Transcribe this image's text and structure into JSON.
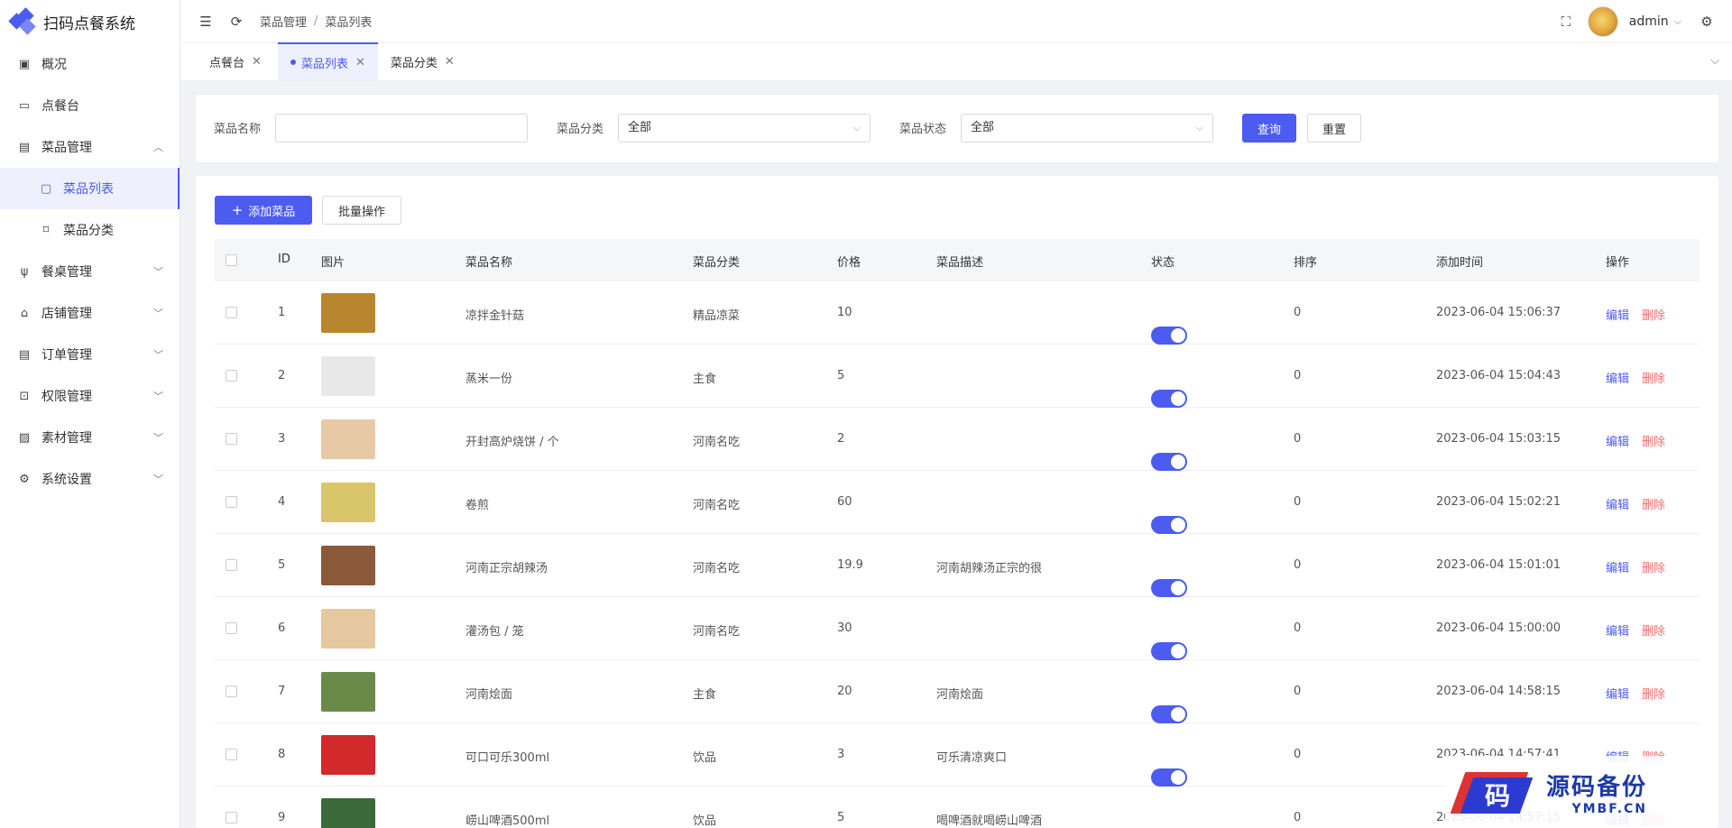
{
  "app": {
    "title": "扫码点餐系统"
  },
  "sidebar": {
    "items": [
      {
        "label": "概况",
        "icon": "dashboard-icon"
      },
      {
        "label": "点餐台",
        "icon": "monitor-icon"
      },
      {
        "label": "菜品管理",
        "icon": "menu-icon",
        "expanded": true
      },
      {
        "label": "菜品列表",
        "icon": "chat-icon",
        "sub": true,
        "active": true
      },
      {
        "label": "菜品分类",
        "icon": "bookmark-icon",
        "sub": true
      },
      {
        "label": "餐桌管理",
        "icon": "cutlery-icon"
      },
      {
        "label": "店铺管理",
        "icon": "store-icon"
      },
      {
        "label": "订单管理",
        "icon": "document-icon"
      },
      {
        "label": "权限管理",
        "icon": "lock-icon"
      },
      {
        "label": "素材管理",
        "icon": "image-icon"
      },
      {
        "label": "系统设置",
        "icon": "gear-icon"
      }
    ]
  },
  "header": {
    "breadcrumb": [
      "菜品管理",
      "菜品列表"
    ],
    "user": "admin"
  },
  "tabs": [
    {
      "label": "点餐台",
      "active": false
    },
    {
      "label": "菜品列表",
      "active": true
    },
    {
      "label": "菜品分类",
      "active": false
    }
  ],
  "search": {
    "name_label": "菜品名称",
    "name_value": "",
    "category_label": "菜品分类",
    "category_value": "全部",
    "status_label": "菜品状态",
    "status_value": "全部",
    "query_button": "查询",
    "reset_button": "重置"
  },
  "toolbar": {
    "add_button": "添加菜品",
    "batch_button": "批量操作"
  },
  "table": {
    "columns": [
      "ID",
      "图片",
      "菜品名称",
      "菜品分类",
      "价格",
      "菜品描述",
      "状态",
      "排序",
      "添加时间",
      "操作"
    ],
    "edit_label": "编辑",
    "delete_label": "删除",
    "rows": [
      {
        "id": "1",
        "name": "凉拌金针菇",
        "category": "精品凉菜",
        "price": "10",
        "desc": "",
        "status": true,
        "sort": "0",
        "time": "2023-06-04 15:06:37",
        "thumb": "#b8862f"
      },
      {
        "id": "2",
        "name": "蒸米一份",
        "category": "主食",
        "price": "5",
        "desc": "",
        "status": true,
        "sort": "0",
        "time": "2023-06-04 15:04:43",
        "thumb": "#e8e8e8"
      },
      {
        "id": "3",
        "name": "开封高炉烧饼 / 个",
        "category": "河南名吃",
        "price": "2",
        "desc": "",
        "status": true,
        "sort": "0",
        "time": "2023-06-04 15:03:15",
        "thumb": "#e8c9a6"
      },
      {
        "id": "4",
        "name": "卷煎",
        "category": "河南名吃",
        "price": "60",
        "desc": "",
        "status": true,
        "sort": "0",
        "time": "2023-06-04 15:02:21",
        "thumb": "#d9c56a"
      },
      {
        "id": "5",
        "name": "河南正宗胡辣汤",
        "category": "河南名吃",
        "price": "19.9",
        "desc": "河南胡辣汤正宗的很",
        "status": true,
        "sort": "0",
        "time": "2023-06-04 15:01:01",
        "thumb": "#8a5a3a"
      },
      {
        "id": "6",
        "name": "灌汤包 / 笼",
        "category": "河南名吃",
        "price": "30",
        "desc": "",
        "status": true,
        "sort": "0",
        "time": "2023-06-04 15:00:00",
        "thumb": "#e6c8a0"
      },
      {
        "id": "7",
        "name": "河南烩面",
        "category": "主食",
        "price": "20",
        "desc": "河南烩面",
        "status": true,
        "sort": "0",
        "time": "2023-06-04 14:58:15",
        "thumb": "#6a8a4a"
      },
      {
        "id": "8",
        "name": "可口可乐300ml",
        "category": "饮品",
        "price": "3",
        "desc": "可乐清凉爽口",
        "status": true,
        "sort": "0",
        "time": "2023-06-04 14:57:41",
        "thumb": "#d22a2a"
      },
      {
        "id": "9",
        "name": "崂山啤酒500ml",
        "category": "饮品",
        "price": "5",
        "desc": "喝啤酒就喝崂山啤酒",
        "status": true,
        "sort": "0",
        "time": "2023-06-04 14:57:15",
        "thumb": "#3a6a3a"
      }
    ]
  },
  "watermark": {
    "cn": "源码备份",
    "en": "YMBF.CN",
    "glyph": "码"
  },
  "colors": {
    "accent": "#4c5cf0",
    "danger": "#f56c6c"
  }
}
